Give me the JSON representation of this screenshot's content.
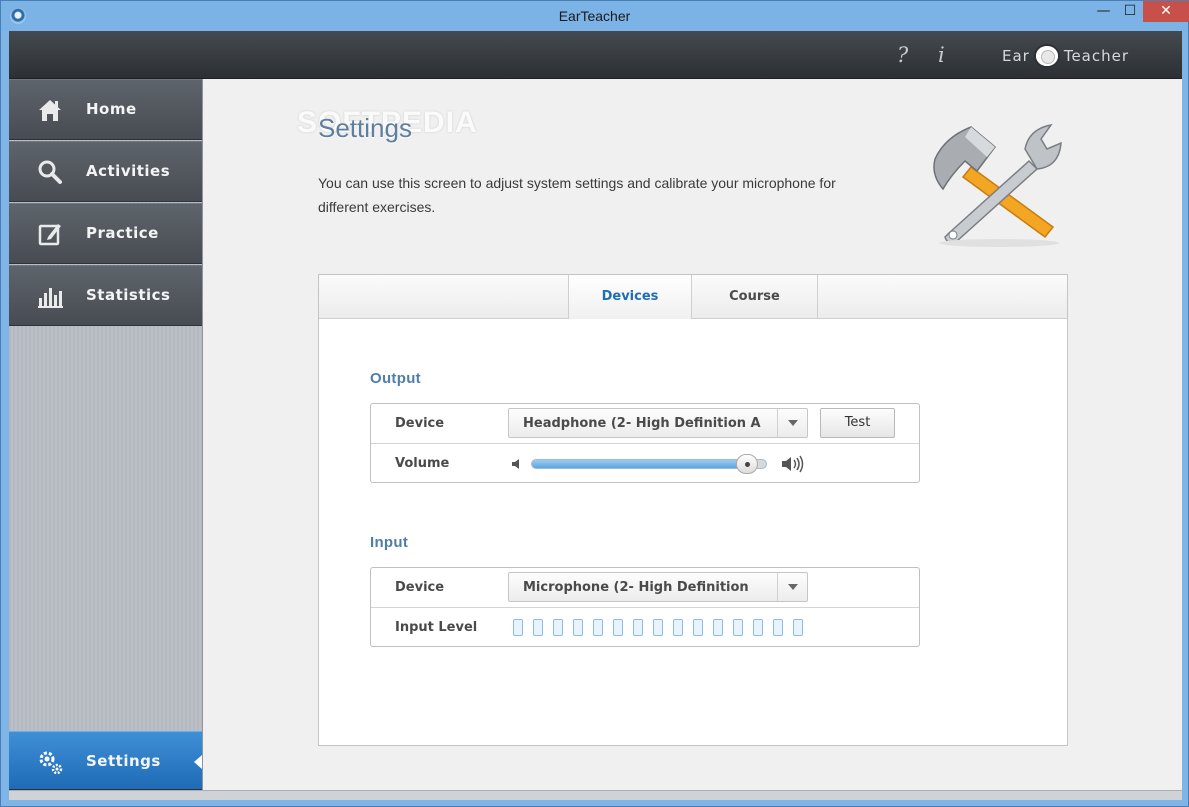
{
  "window": {
    "title": "EarTeacher",
    "minimize": "—",
    "maximize": "☐",
    "close": "✕"
  },
  "header": {
    "help": "?",
    "info": "i",
    "logo_left": "Ear",
    "logo_right": "Teacher"
  },
  "sidebar": {
    "items": [
      {
        "label": "Home",
        "icon": "home-icon"
      },
      {
        "label": "Activities",
        "icon": "search-icon"
      },
      {
        "label": "Practice",
        "icon": "edit-icon"
      },
      {
        "label": "Statistics",
        "icon": "bar-chart-icon"
      }
    ],
    "settings": {
      "label": "Settings",
      "icon": "gears-icon",
      "selected": true
    }
  },
  "main": {
    "watermark": "SOFTPEDIA",
    "title": "Settings",
    "description": "You can use this screen to adjust system settings and calibrate your microphone for different exercises.",
    "tabs": [
      {
        "label": "Devices",
        "active": true
      },
      {
        "label": "Course",
        "active": false
      }
    ],
    "output": {
      "title": "Output",
      "device_label": "Device",
      "device_value": "Headphone (2- High Definition A",
      "test_label": "Test",
      "volume_label": "Volume",
      "volume_fraction": 0.96
    },
    "input": {
      "title": "Input",
      "device_label": "Device",
      "device_value": "Microphone (2- High Definition",
      "level_label": "Input Level",
      "level_segments": 15,
      "level_active": 0
    }
  },
  "colors": {
    "accent": "#1f6fb5",
    "section_title": "#4f7fa8",
    "sidebar_selected": "#2a7cc6"
  }
}
